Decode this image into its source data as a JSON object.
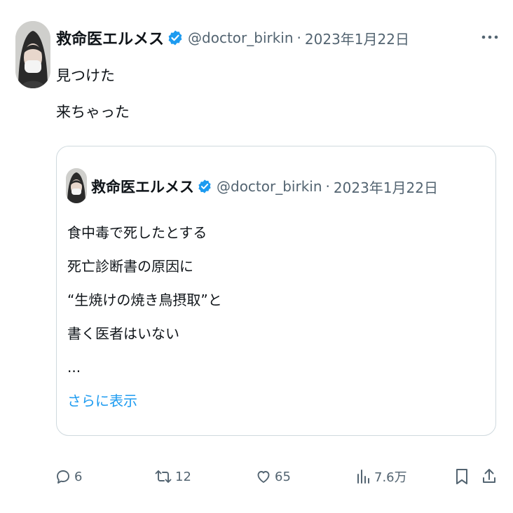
{
  "tweet": {
    "author_name": "救命医エルメス",
    "handle": "@doctor_birkin",
    "separator": "·",
    "date": "2023年1月22日",
    "lines": [
      "見つけた",
      "来ちゃった"
    ],
    "more_icon": "more-horizontal-icon"
  },
  "quoted": {
    "author_name": "救命医エルメス",
    "handle": "@doctor_birkin",
    "separator": "·",
    "date": "2023年1月22日",
    "lines": [
      "食中毒で死したとする",
      "死亡診断書の原因に",
      "“生焼けの焼き鳥摂取”と",
      "書く医者はいない",
      "..."
    ],
    "show_more": "さらに表示"
  },
  "actions": {
    "reply_count": "6",
    "retweet_count": "12",
    "like_count": "65",
    "views_count": "7.6万"
  },
  "colors": {
    "verified": "#1d9bf0",
    "link": "#1d9bf0",
    "muted": "#536471",
    "border": "#cfd9de"
  }
}
